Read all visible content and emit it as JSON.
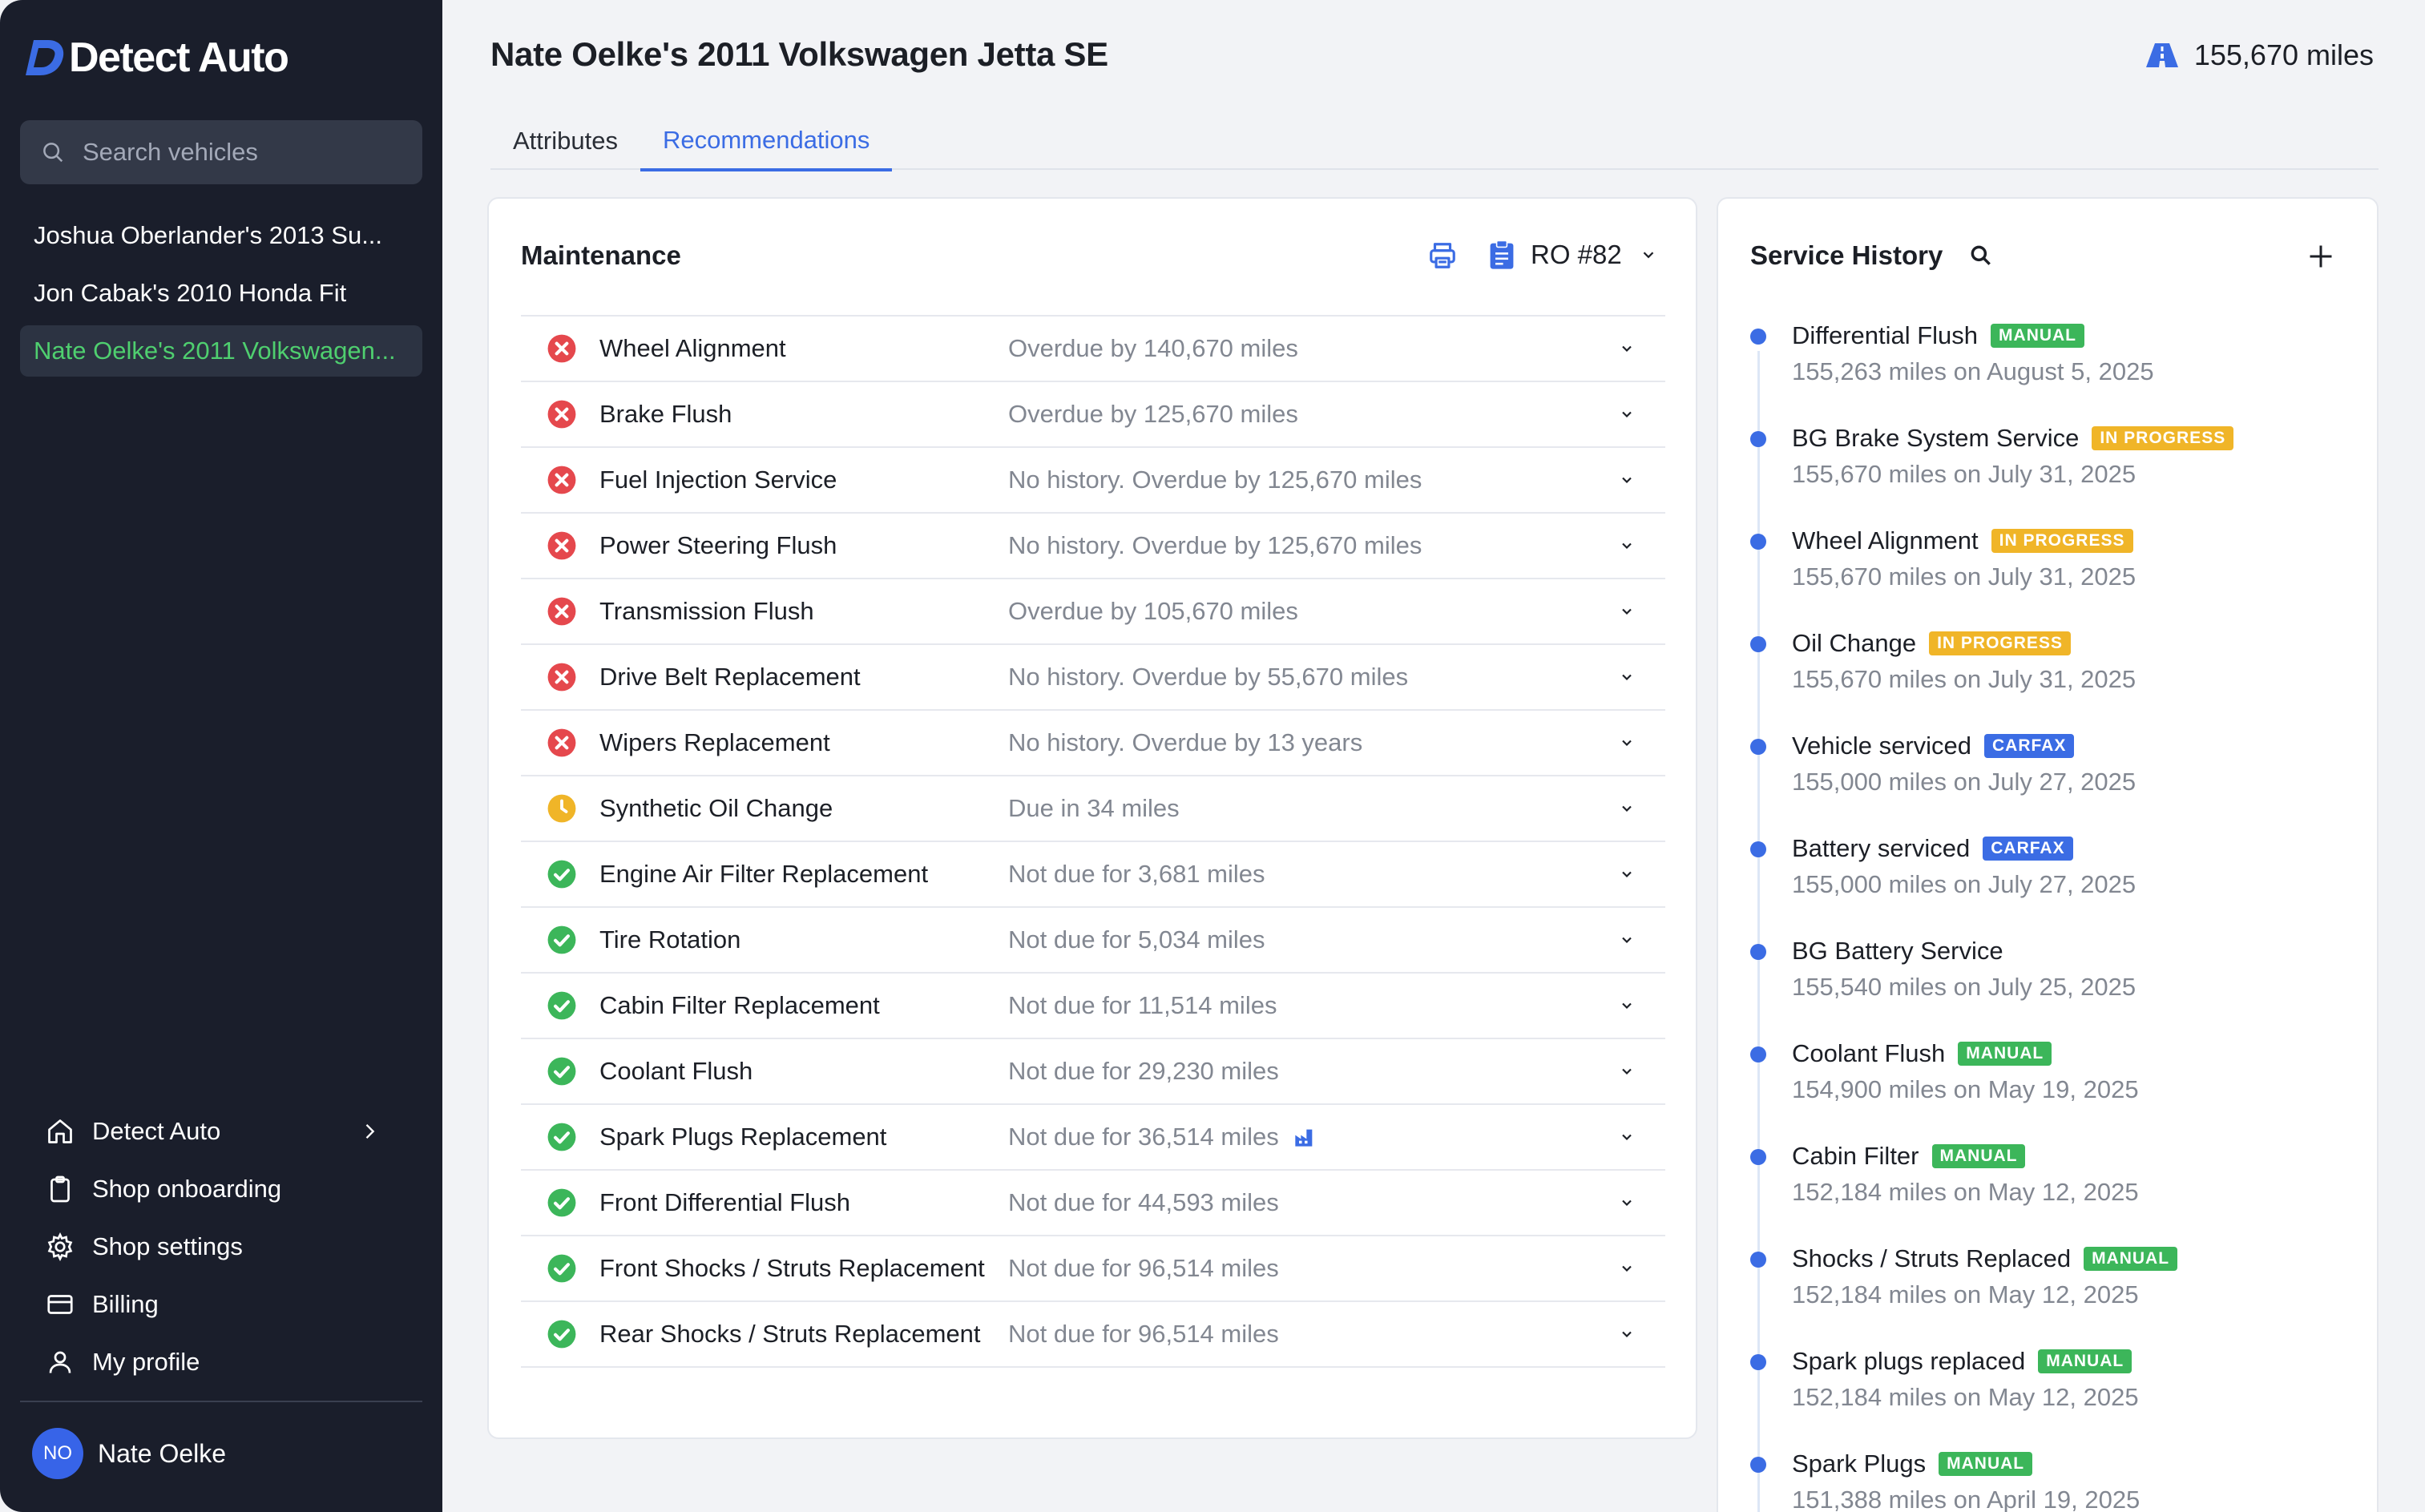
{
  "brand": {
    "name": "Detect Auto"
  },
  "search": {
    "placeholder": "Search vehicles"
  },
  "vehicles": [
    {
      "label": "Joshua Oberlander's 2013 Su..."
    },
    {
      "label": "Jon Cabak's 2010 Honda Fit"
    },
    {
      "label": "Nate Oelke's 2011 Volkswagen..."
    }
  ],
  "nav": {
    "detect_auto": "Detect Auto",
    "shop_onboarding": "Shop onboarding",
    "shop_settings": "Shop settings",
    "billing": "Billing",
    "my_profile": "My profile"
  },
  "user": {
    "initials": "NO",
    "name": "Nate Oelke"
  },
  "header": {
    "title": "Nate Oelke's 2011 Volkswagen Jetta SE",
    "mileage": "155,670 miles"
  },
  "tabs": {
    "attributes": "Attributes",
    "recommendations": "Recommendations"
  },
  "maintenance": {
    "title": "Maintenance",
    "ro_label": "RO #82",
    "rows": [
      {
        "name": "Wheel Alignment",
        "desc": "Overdue by 140,670 miles",
        "status": "overdue"
      },
      {
        "name": "Brake Flush",
        "desc": "Overdue by 125,670 miles",
        "status": "overdue"
      },
      {
        "name": "Fuel Injection Service",
        "desc": "No history. Overdue by 125,670 miles",
        "status": "overdue"
      },
      {
        "name": "Power Steering Flush",
        "desc": "No history. Overdue by 125,670 miles",
        "status": "overdue"
      },
      {
        "name": "Transmission Flush",
        "desc": "Overdue by 105,670 miles",
        "status": "overdue"
      },
      {
        "name": "Drive Belt Replacement",
        "desc": "No history. Overdue by 55,670 miles",
        "status": "overdue"
      },
      {
        "name": "Wipers Replacement",
        "desc": "No history. Overdue by 13 years",
        "status": "overdue"
      },
      {
        "name": "Synthetic Oil Change",
        "desc": "Due in 34 miles",
        "status": "due"
      },
      {
        "name": "Engine Air Filter Replacement",
        "desc": "Not due for 3,681 miles",
        "status": "ok"
      },
      {
        "name": "Tire Rotation",
        "desc": "Not due for 5,034 miles",
        "status": "ok"
      },
      {
        "name": "Cabin Filter Replacement",
        "desc": "Not due for 11,514 miles",
        "status": "ok"
      },
      {
        "name": "Coolant Flush",
        "desc": "Not due for 29,230 miles",
        "status": "ok"
      },
      {
        "name": "Spark Plugs Replacement",
        "desc": "Not due for 36,514 miles",
        "status": "ok",
        "icon": "factory-icon"
      },
      {
        "name": "Front Differential Flush",
        "desc": "Not due for 44,593 miles",
        "status": "ok"
      },
      {
        "name": "Front Shocks / Struts Replacement",
        "desc": "Not due for 96,514 miles",
        "status": "ok"
      },
      {
        "name": "Rear Shocks / Struts Replacement",
        "desc": "Not due for 96,514 miles",
        "status": "ok"
      }
    ]
  },
  "service_history": {
    "title": "Service History",
    "items": [
      {
        "title": "Differential Flush",
        "badge": "MANUAL",
        "badge_type": "manual",
        "sub": "155,263 miles on August 5, 2025"
      },
      {
        "title": "BG Brake System Service",
        "badge": "IN PROGRESS",
        "badge_type": "progress",
        "sub": "155,670 miles on July 31, 2025"
      },
      {
        "title": "Wheel Alignment",
        "badge": "IN PROGRESS",
        "badge_type": "progress",
        "sub": "155,670 miles on July 31, 2025"
      },
      {
        "title": "Oil Change",
        "badge": "IN PROGRESS",
        "badge_type": "progress",
        "sub": "155,670 miles on July 31, 2025"
      },
      {
        "title": "Vehicle serviced",
        "badge": "CARFAX",
        "badge_type": "carfax",
        "sub": "155,000 miles on July 27, 2025"
      },
      {
        "title": "Battery serviced",
        "badge": "CARFAX",
        "badge_type": "carfax",
        "sub": "155,000 miles on July 27, 2025"
      },
      {
        "title": "BG Battery Service",
        "badge": "",
        "badge_type": "",
        "sub": "155,540 miles on July 25, 2025"
      },
      {
        "title": "Coolant Flush",
        "badge": "MANUAL",
        "badge_type": "manual",
        "sub": "154,900 miles on May 19, 2025"
      },
      {
        "title": "Cabin Filter",
        "badge": "MANUAL",
        "badge_type": "manual",
        "sub": "152,184 miles on May 12, 2025"
      },
      {
        "title": "Shocks / Struts Replaced",
        "badge": "MANUAL",
        "badge_type": "manual",
        "sub": "152,184 miles on May 12, 2025"
      },
      {
        "title": "Spark plugs replaced",
        "badge": "MANUAL",
        "badge_type": "manual",
        "sub": "152,184 miles on May 12, 2025"
      },
      {
        "title": "Spark Plugs",
        "badge": "MANUAL",
        "badge_type": "manual",
        "sub": "151,388 miles on April 19, 2025"
      }
    ]
  },
  "colors": {
    "sidebar_bg": "#1a1e2b",
    "accent": "#3b6ce4",
    "active_vehicle": "#4fcf6f",
    "overdue": "#e5484d",
    "due": "#f0b528",
    "ok": "#3cb65a"
  }
}
